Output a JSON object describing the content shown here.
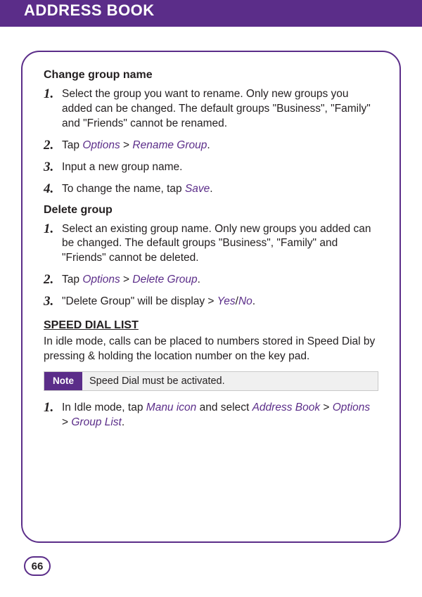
{
  "header": {
    "title": "ADDRESS BOOK"
  },
  "sections": {
    "changeGroup": {
      "heading": "Change group name",
      "steps": [
        {
          "n": "1.",
          "html": "Select the group you want to rename. Only new groups you added can be changed. The default groups \"Business\", \"Family\" and \"Friends\" cannot be renamed."
        },
        {
          "n": "2.",
          "html": "Tap <span class=\"ui\">Options</span> > <span class=\"ui\">Rename Group</span>."
        },
        {
          "n": "3.",
          "html": "Input a new group name."
        },
        {
          "n": "4.",
          "html": "To change the name, tap <span class=\"ui\">Save</span>."
        }
      ]
    },
    "deleteGroup": {
      "heading": "Delete group",
      "steps": [
        {
          "n": "1.",
          "html": "Select an existing group name. Only new groups you added can be changed. The default groups \"Business\", \"Family\" and \"Friends\" cannot be deleted."
        },
        {
          "n": "2.",
          "html": "Tap <span class=\"ui\">Options</span> > <span class=\"ui\">Delete Group</span>."
        },
        {
          "n": "3.",
          "html": "\"Delete Group\" will be display > <span class=\"ui\">Yes</span>/<span class=\"ui\">No</span>."
        }
      ]
    },
    "speedDial": {
      "heading": "SPEED DIAL LIST",
      "intro": "In idle mode, calls can be placed to numbers stored in Speed Dial by pressing & holding the location number on the key pad.",
      "noteLabel": "Note",
      "noteText": "Speed Dial must be activated.",
      "steps": [
        {
          "n": "1.",
          "html": "In Idle mode, tap <span class=\"ui\">Manu icon</span> and select <span class=\"ui\">Address Book</span> > <span class=\"ui\">Options</span> > <span class=\"ui\">Group List</span>."
        }
      ]
    }
  },
  "pageNumber": "66"
}
